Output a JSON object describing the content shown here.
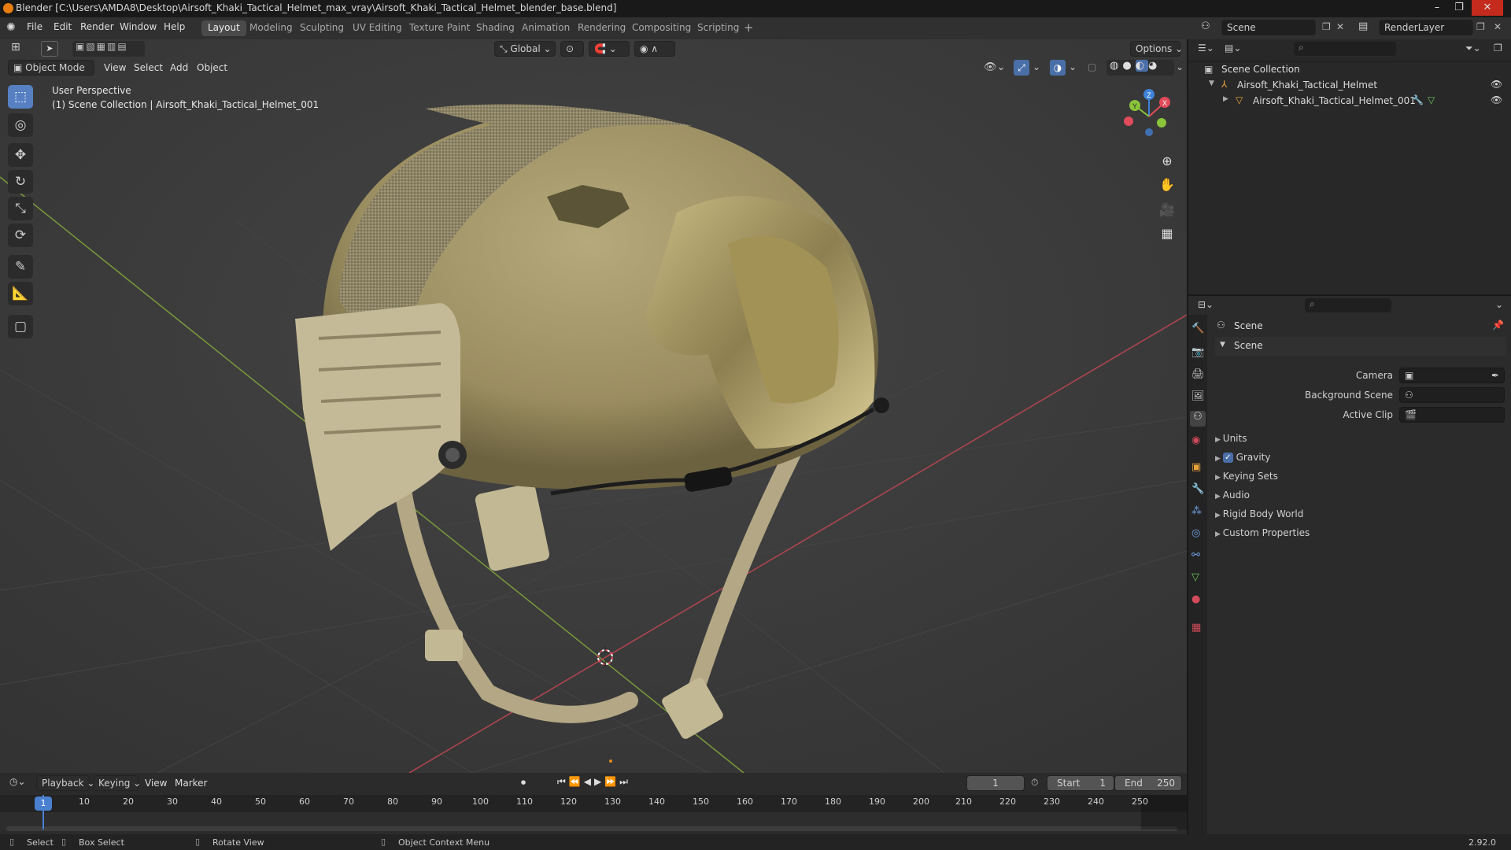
{
  "window": {
    "title": "Blender [C:\\Users\\AMDA8\\Desktop\\Airsoft_Khaki_Tactical_Helmet_max_vray\\Airsoft_Khaki_Tactical_Helmet_blender_base.blend]",
    "minimize": "–",
    "maximize": "❐",
    "close": "✕"
  },
  "menu": {
    "items": [
      "File",
      "Edit",
      "Render",
      "Window",
      "Help"
    ]
  },
  "workspaces": {
    "tabs": [
      "Layout",
      "Modeling",
      "Sculpting",
      "UV Editing",
      "Texture Paint",
      "Shading",
      "Animation",
      "Rendering",
      "Compositing",
      "Scripting"
    ],
    "add": "+"
  },
  "topright": {
    "scene": "Scene",
    "render_layer": "RenderLayer"
  },
  "viewport": {
    "mode": "Object Mode",
    "menus": [
      "View",
      "Select",
      "Add",
      "Object"
    ],
    "orientation": "Global",
    "options": "Options",
    "overlay_title": "User Perspective",
    "overlay_subtitle": "(1) Scene Collection | Airsoft_Khaki_Tactical_Helmet_001",
    "gizmo": {
      "x": "X",
      "y": "Y",
      "z": "Z"
    }
  },
  "outliner": {
    "root": "Scene Collection",
    "items": [
      "Airsoft_Khaki_Tactical_Helmet",
      "Airsoft_Khaki_Tactical_Helmet_001"
    ]
  },
  "properties": {
    "header": "Scene",
    "panel": "Scene",
    "fields": [
      {
        "label": "Camera"
      },
      {
        "label": "Background Scene"
      },
      {
        "label": "Active Clip"
      }
    ],
    "subpanels": [
      "Units",
      "Gravity",
      "Keying Sets",
      "Audio",
      "Rigid Body World",
      "Custom Properties"
    ],
    "gravity_checked": true
  },
  "timeline": {
    "menus": [
      "Playback",
      "Keying",
      "View",
      "Marker"
    ],
    "current_frame": "1",
    "start_label": "Start",
    "start": "1",
    "end_label": "End",
    "end": "250",
    "ticks": [
      "1",
      "10",
      "20",
      "30",
      "40",
      "50",
      "60",
      "70",
      "80",
      "90",
      "100",
      "110",
      "120",
      "130",
      "140",
      "150",
      "160",
      "170",
      "180",
      "190",
      "200",
      "210",
      "220",
      "230",
      "240",
      "250"
    ]
  },
  "status": {
    "select": "Select",
    "box_select": "Box Select",
    "rotate_view": "Rotate View",
    "context_menu": "Object Context Menu",
    "version": "2.92.0"
  },
  "colors": {
    "accent": "#5680c2",
    "x_axis": "#e04a5a",
    "y_axis": "#8ac43a",
    "z_axis": "#3f82d8",
    "helmet": "#a79a6c"
  }
}
